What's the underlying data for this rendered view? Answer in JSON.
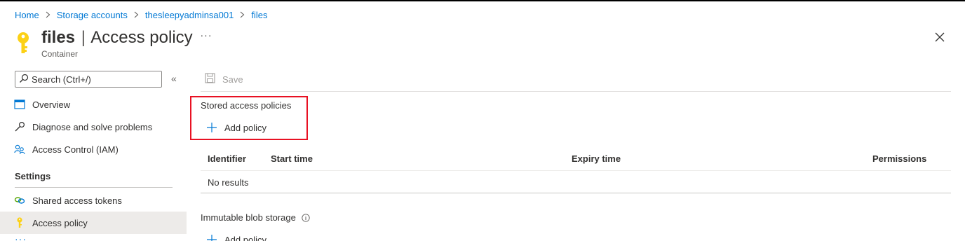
{
  "breadcrumb": {
    "items": [
      "Home",
      "Storage accounts",
      "thesleepyadminsa001",
      "files"
    ]
  },
  "header": {
    "title_name": "files",
    "title_sep": "|",
    "title_page": "Access policy",
    "subtitle": "Container",
    "more_label": "···",
    "icon": "key-icon",
    "icon_color": "#fcd116"
  },
  "sidebar": {
    "search_placeholder": "Search (Ctrl+/)",
    "collapse_label": "«",
    "items": [
      {
        "label": "Overview",
        "icon": "overview-icon"
      },
      {
        "label": "Diagnose and solve problems",
        "icon": "wrench-icon"
      },
      {
        "label": "Access Control (IAM)",
        "icon": "people-icon"
      }
    ],
    "settings_label": "Settings",
    "settings_items": [
      {
        "label": "Shared access tokens",
        "icon": "link-icon"
      },
      {
        "label": "Access policy",
        "icon": "key-icon",
        "active": true
      }
    ],
    "more_label": "···"
  },
  "toolbar": {
    "save_label": "Save"
  },
  "stored_access_policies": {
    "label": "Stored access policies",
    "add_label": "Add policy",
    "columns": [
      "Identifier",
      "Start time",
      "Expiry time",
      "Permissions"
    ],
    "empty_text": "No results"
  },
  "immutable_blob_storage": {
    "label": "Immutable blob storage",
    "add_label": "Add policy"
  },
  "colors": {
    "accent": "#0078d4",
    "highlight_border": "#e81123"
  }
}
